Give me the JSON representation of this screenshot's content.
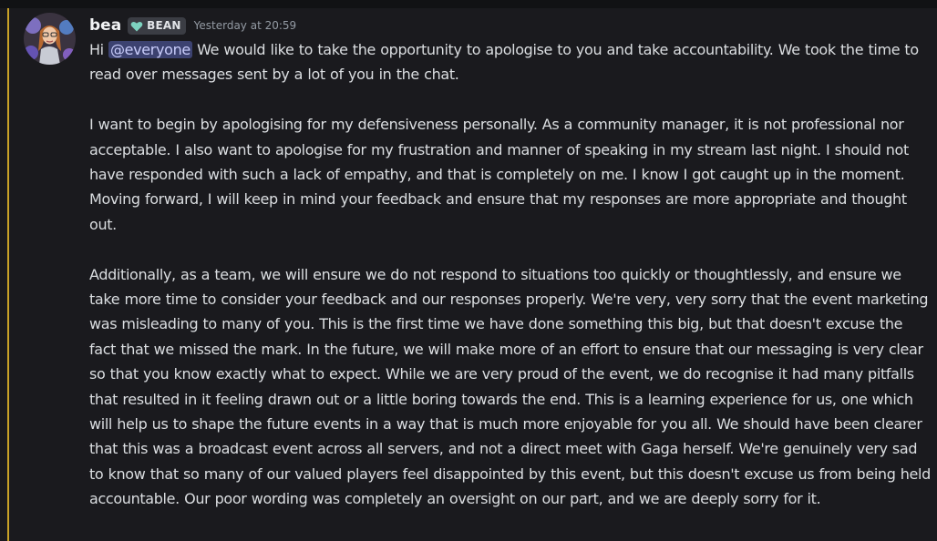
{
  "message": {
    "author": "bea",
    "role_tag": "BEAN",
    "role_color": "#7dd3c0",
    "timestamp": "Yesterday at 20:59",
    "mention": "@everyone",
    "paragraph1_prefix": "Hi",
    "paragraph1_rest": "We would like to take the opportunity to apologise to you and take accountability. We took the time to read over messages sent by a lot of you in the chat.",
    "paragraph2": "I want to begin by apologising for my defensiveness personally. As a community manager, it is not professional nor acceptable. I also want to apologise for my frustration and manner of speaking in my stream last night. I should not have responded with such a lack of empathy, and that is completely on me. I know I got caught up in the moment. Moving forward, I will keep in mind your feedback and ensure that my responses are more appropriate and thought out.",
    "paragraph3": "Additionally, as a team, we will ensure we do not respond to situations too quickly or thoughtlessly, and ensure we take more time to consider your feedback and our responses properly. We're very, very sorry that the event marketing was misleading to many of you. This is the first time we have done something this big, but that doesn't excuse the fact that we missed the mark. In the future, we will make more of an effort to ensure that our messaging is very clear so that you know exactly what to expect. While we are very proud of the event, we do recognise it had many pitfalls that resulted in it feeling drawn out or a little boring towards the end. This is a learning experience for us, one which will help us to shape the future events in a way that is much more enjoyable for you all. We should have been clearer that this was a broadcast event across all servers, and not a direct meet with Gaga herself. We're genuinely very sad to know that so many of our valued players feel disappointed by this event, but this doesn't excuse us from being held accountable. Our poor wording was completely an oversight on our part, and we are deeply sorry for it."
  },
  "colors": {
    "background": "#1a1a1e",
    "highlight_bar": "#c9a227",
    "mention_bg": "#3c4270",
    "text": "#dbdee1"
  },
  "icons": {
    "avatar": "user-avatar",
    "role": "heart-icon"
  }
}
